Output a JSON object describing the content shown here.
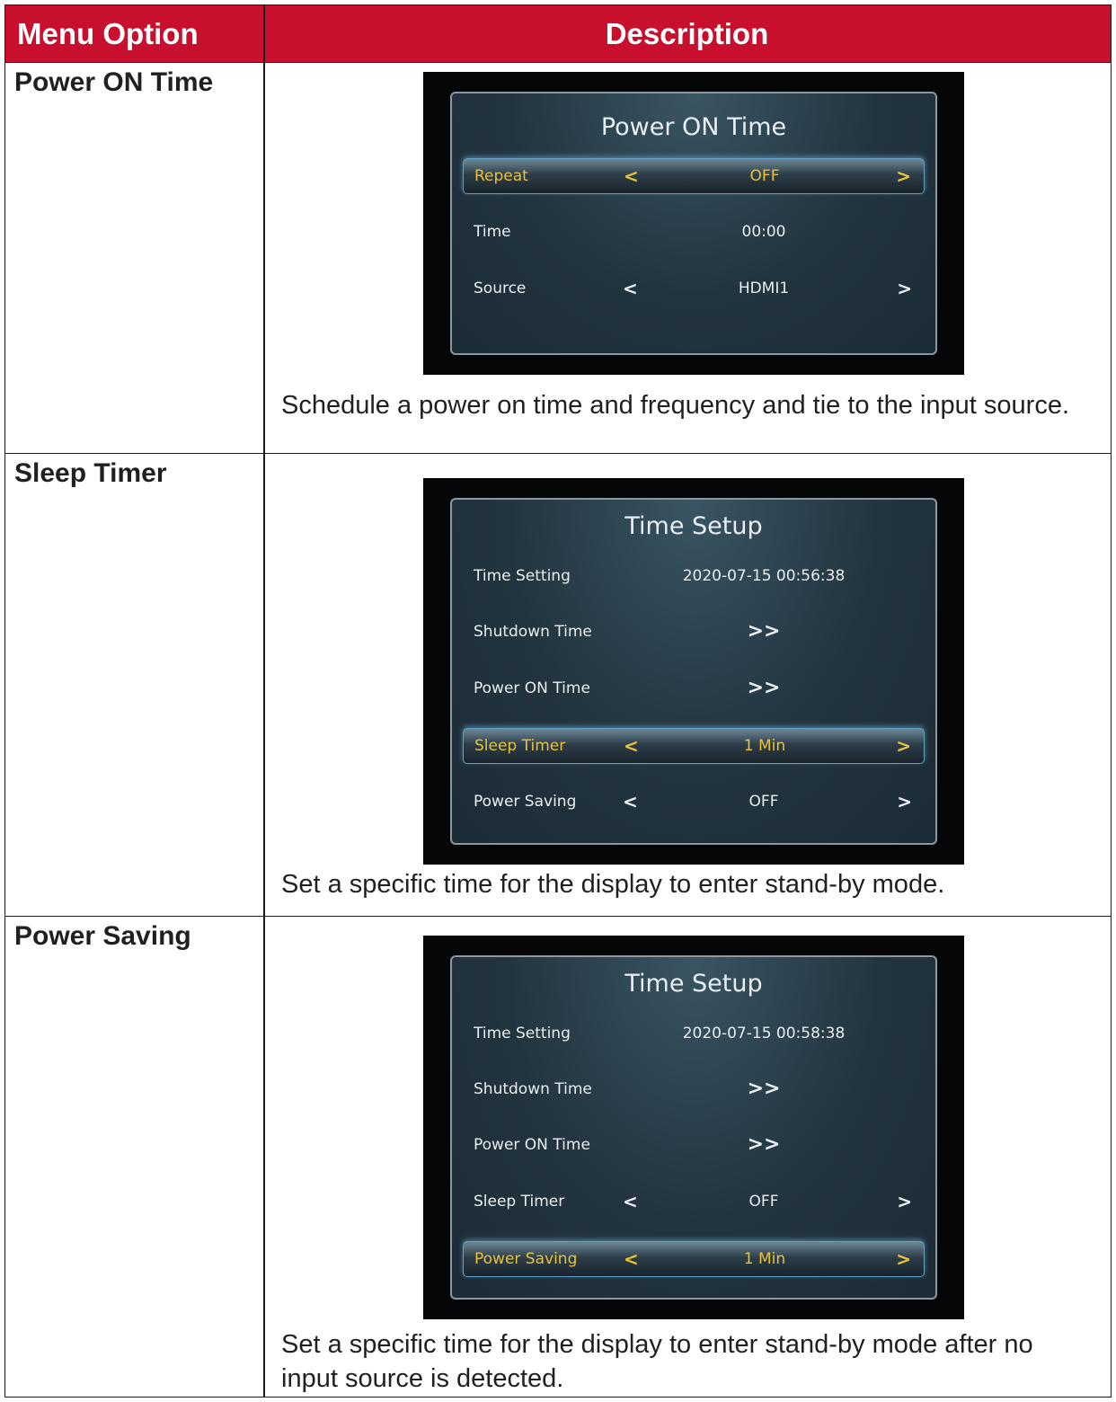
{
  "header": {
    "menu_option": "Menu Option",
    "description": "Description"
  },
  "rows": [
    {
      "label": "Power ON Time",
      "description": "Schedule a power on time and frequency and tie to the input source.",
      "osd": {
        "title": "Power ON Time",
        "items": [
          {
            "label": "Repeat",
            "left": "<",
            "value": "OFF",
            "right": ">",
            "selected": true
          },
          {
            "label": "Time",
            "value": "00:00"
          },
          {
            "label": "Source",
            "left": "<",
            "value": "HDMI1",
            "right": ">"
          }
        ]
      }
    },
    {
      "label": "Sleep Timer",
      "description": "Set a specific time for the display to enter stand-by mode.",
      "osd": {
        "title": "Time Setup",
        "items": [
          {
            "label": "Time Setting",
            "value": "2020-07-15 00:56:38"
          },
          {
            "label": "Shutdown Time",
            "value": ">>"
          },
          {
            "label": "Power ON Time",
            "value": ">>"
          },
          {
            "label": "Sleep Timer",
            "left": "<",
            "value": "1 Min",
            "right": ">",
            "selected": true
          },
          {
            "label": "Power Saving",
            "left": "<",
            "value": "OFF",
            "right": ">"
          }
        ]
      }
    },
    {
      "label": "Power Saving",
      "description": "Set a specific time for the display to enter stand-by mode after no input source is detected.",
      "osd": {
        "title": "Time Setup",
        "items": [
          {
            "label": "Time Setting",
            "value": "2020-07-15 00:58:38"
          },
          {
            "label": "Shutdown Time",
            "value": ">>"
          },
          {
            "label": "Power ON Time",
            "value": ">>"
          },
          {
            "label": "Sleep Timer",
            "left": "<",
            "value": "OFF",
            "right": ">"
          },
          {
            "label": "Power Saving",
            "left": "<",
            "value": "1 Min",
            "right": ">",
            "selected": true
          }
        ]
      }
    }
  ]
}
